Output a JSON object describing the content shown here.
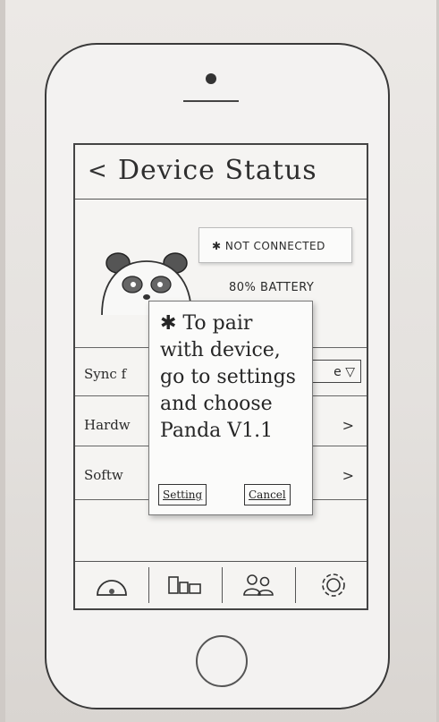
{
  "screen": {
    "back_icon": "<",
    "title": "Device Status",
    "connection_status": "NOT CONNECTED",
    "battery": "80% BATTERY"
  },
  "rows": [
    {
      "label": "Sync f",
      "control": "e ▽"
    },
    {
      "label": "Hardw",
      "control": ">"
    },
    {
      "label": "Softw",
      "control": ">"
    }
  ],
  "dialog": {
    "message": "✱ To pair\nwith device,\ngo to settings\nand choose\nPanda V1.1",
    "setting_button": "Setting",
    "cancel_button": "Cancel"
  },
  "tabbar": {
    "tabs": [
      {
        "icon": "dashboard-icon"
      },
      {
        "icon": "devices-icon"
      },
      {
        "icon": "users-icon"
      },
      {
        "icon": "gear-icon"
      }
    ]
  }
}
